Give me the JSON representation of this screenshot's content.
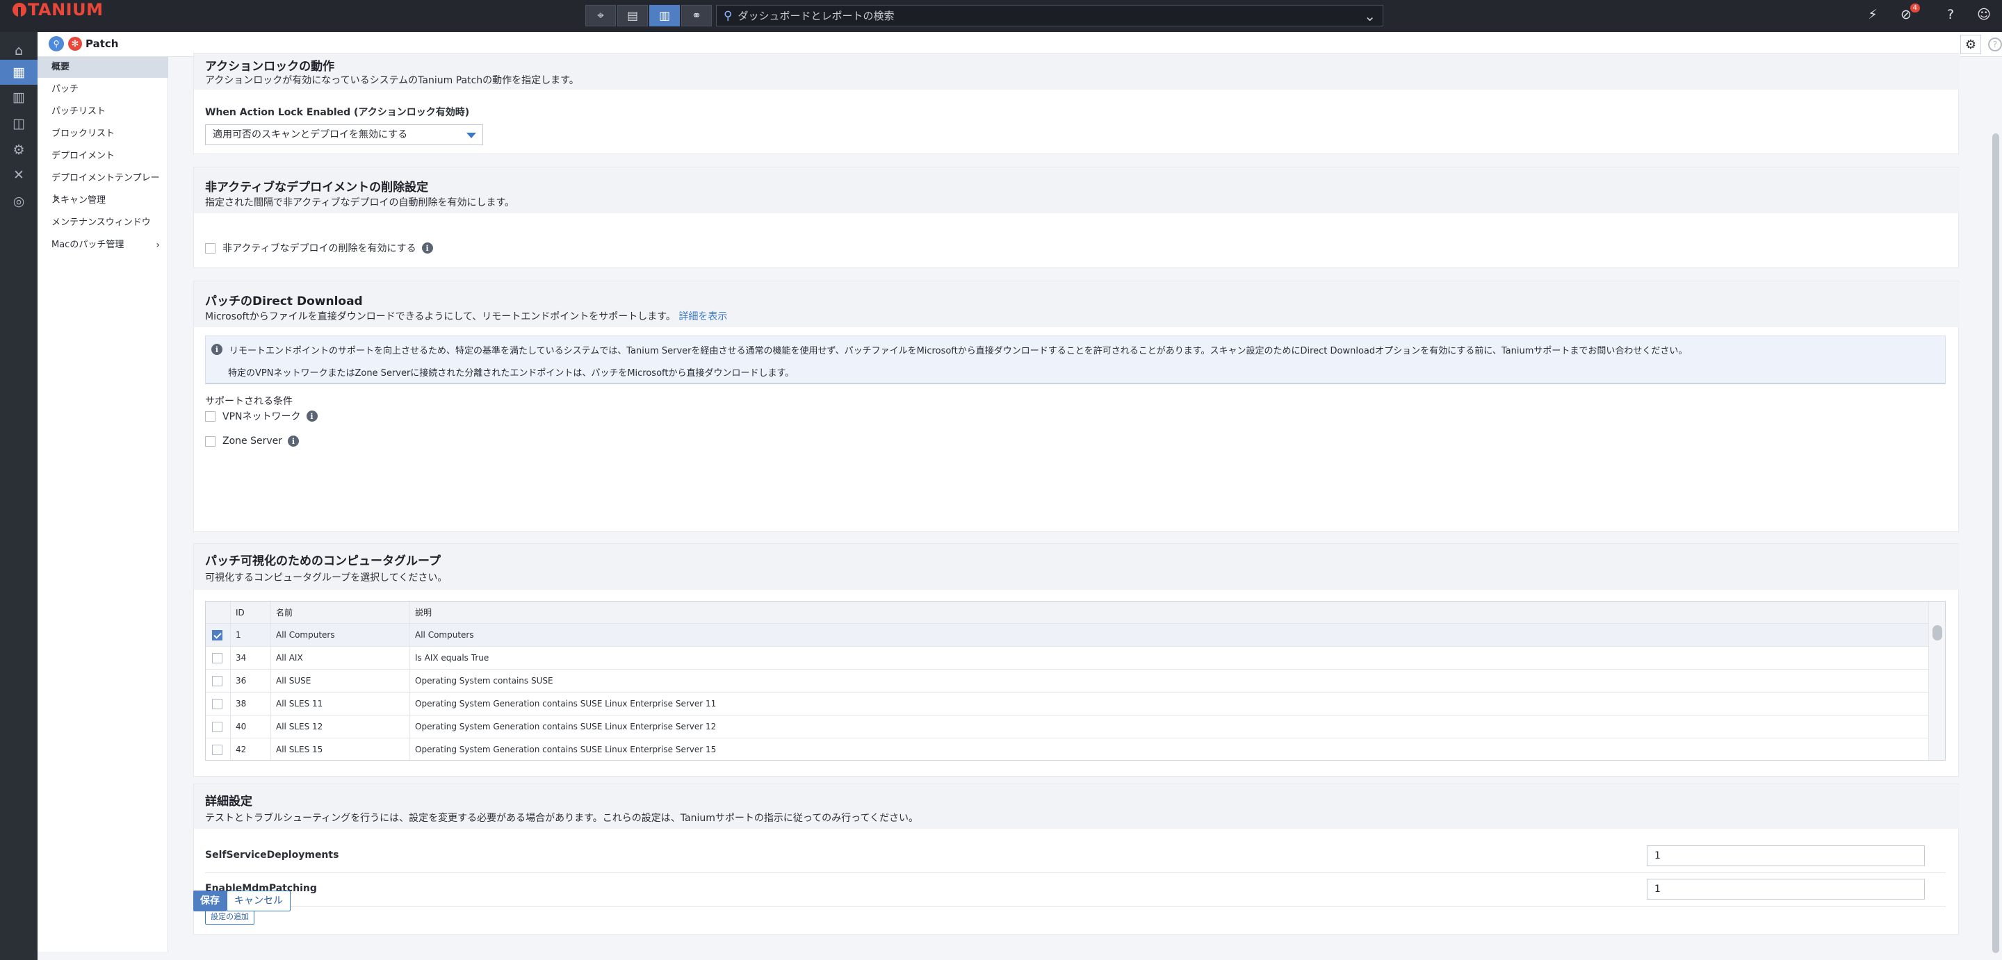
{
  "topbar": {
    "logo": "TANIUM",
    "search_placeholder": "ダッシュボードとレポートの検索",
    "notification_count": "4"
  },
  "subheader": {
    "module": "Patch"
  },
  "menu": {
    "items": [
      {
        "label": "概要"
      },
      {
        "label": "パッチ"
      },
      {
        "label": "パッチリスト"
      },
      {
        "label": "ブロックリスト"
      },
      {
        "label": "デプロイメント"
      },
      {
        "label": "デプロイメントテンプレート"
      },
      {
        "label": "スキャン管理"
      },
      {
        "label": "メンテナンスウィンドウ"
      },
      {
        "label": "Macのパッチ管理"
      }
    ]
  },
  "action_lock": {
    "title": "アクションロックの動作",
    "desc": "アクションロックが有効になっているシステムのTanium Patchの動作を指定します。",
    "field_label": "When Action Lock Enabled (アクションロック有効時)",
    "select_value": "適用可否のスキャンとデプロイを無効にする"
  },
  "inactive_delete": {
    "title": "非アクティブなデプロイメントの削除設定",
    "desc": "指定された間隔で非アクティブなデプロイの自動削除を有効にします。",
    "checkbox_label": "非アクティブなデプロイの削除を有効にする"
  },
  "direct_download": {
    "title": "パッチのDirect Download",
    "desc": "Microsoftからファイルを直接ダウンロードできるようにして、リモートエンドポイントをサポートします。",
    "link": "詳細を表示",
    "info_line1": "リモートエンドポイントのサポートを向上させるため、特定の基準を満たしているシステムでは、Tanium Serverを経由させる通常の機能を使用せず、パッチファイルをMicrosoftから直接ダウンロードすることを許可されることがあります。スキャン設定のためにDirect Downloadオプションを有効にする前に、Taniumサポートまでお問い合わせください。",
    "info_line2": "特定のVPNネットワークまたはZone Serverに接続された分離されたエンドポイントは、パッチをMicrosoftから直接ダウンロードします。",
    "conditions_label": "サポートされる条件",
    "vpn_label": "VPNネットワーク",
    "zone_label": "Zone Server"
  },
  "computer_groups": {
    "title": "パッチ可視化のためのコンピュータグループ",
    "desc": "可視化するコンピュータグループを選択してください。",
    "columns": {
      "id": "ID",
      "name": "名前",
      "desc": "説明"
    },
    "rows": [
      {
        "id": "1",
        "name": "All Computers",
        "desc": "All Computers",
        "checked": true
      },
      {
        "id": "34",
        "name": "All AIX",
        "desc": "Is AIX equals True",
        "checked": false
      },
      {
        "id": "36",
        "name": "All SUSE",
        "desc": "Operating System contains SUSE",
        "checked": false
      },
      {
        "id": "38",
        "name": "All SLES 11",
        "desc": "Operating System Generation contains SUSE Linux Enterprise Server 11",
        "checked": false
      },
      {
        "id": "40",
        "name": "All SLES 12",
        "desc": "Operating System Generation contains SUSE Linux Enterprise Server 12",
        "checked": false
      },
      {
        "id": "42",
        "name": "All SLES 15",
        "desc": "Operating System Generation contains SUSE Linux Enterprise Server 15",
        "checked": false
      }
    ]
  },
  "advanced": {
    "title": "詳細設定",
    "desc": "テストとトラブルシューティングを行うには、設定を変更する必要がある場合があります。これらの設定は、Taniumサポートの指示に従ってのみ行ってください。",
    "settings": [
      {
        "key": "SelfServiceDeployments",
        "value": "1"
      },
      {
        "key": "EnableMdmPatching",
        "value": "1"
      }
    ],
    "add_button": "設定の追加"
  },
  "footer": {
    "save": "保存",
    "cancel": "キャンセル"
  }
}
